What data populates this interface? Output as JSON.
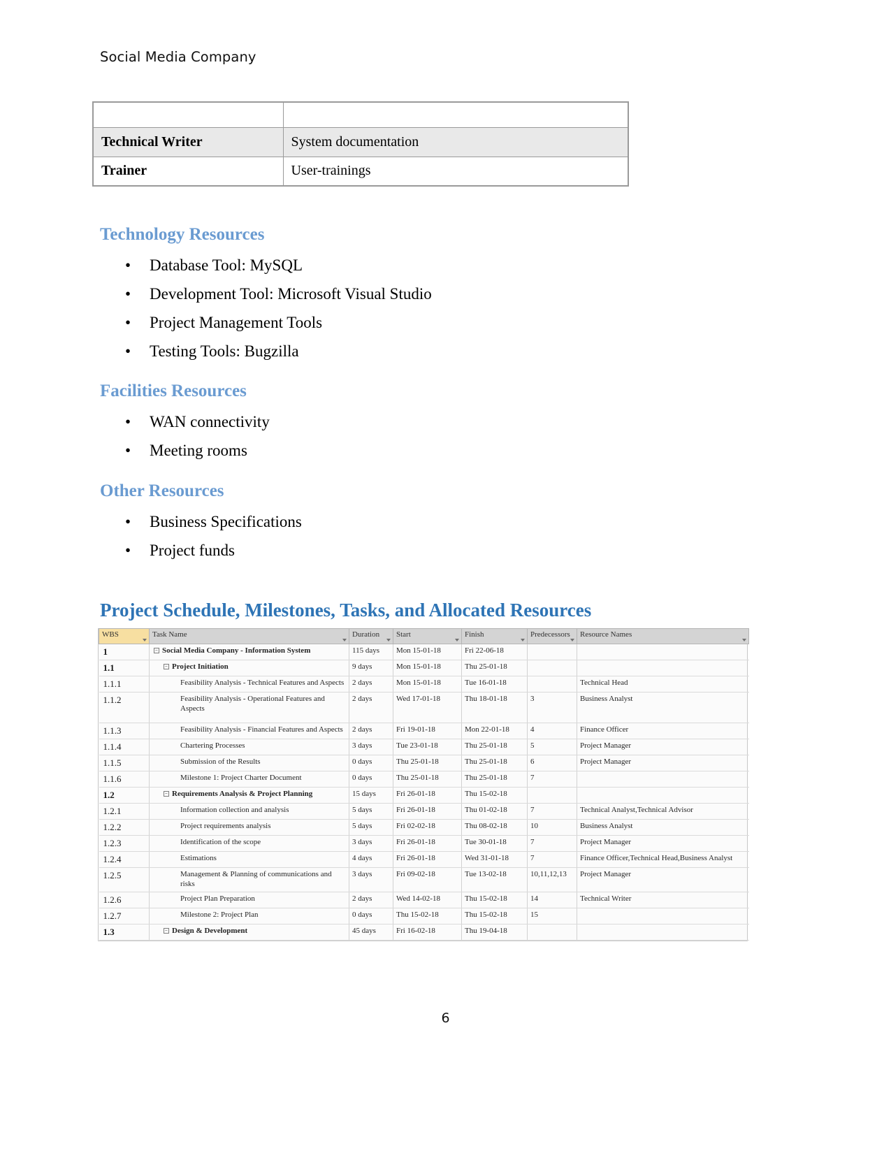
{
  "document": {
    "header_text": "Social Media Company",
    "page_number": "6"
  },
  "roles_table": {
    "rows": [
      {
        "role": "",
        "description": ""
      },
      {
        "role": "Technical Writer",
        "description": "System documentation"
      },
      {
        "role": "Trainer",
        "description": "User-trainings"
      }
    ]
  },
  "sections": [
    {
      "heading": "Technology Resources",
      "items": [
        "Database Tool: MySQL",
        "Development Tool: Microsoft Visual Studio",
        "Project Management Tools",
        "Testing Tools: Bugzilla"
      ]
    },
    {
      "heading": "Facilities Resources",
      "items": [
        "WAN connectivity",
        "Meeting rooms"
      ]
    },
    {
      "heading": "Other Resources",
      "items": [
        "Business Specifications",
        "Project funds"
      ]
    }
  ],
  "schedule": {
    "heading": "Project Schedule, Milestones, Tasks, and Allocated Resources",
    "bullet_glyph": "•",
    "expander_glyph": "−",
    "columns": [
      "WBS",
      "Task Name",
      "Duration",
      "Start",
      "Finish",
      "Predecessors",
      "Resource Names"
    ],
    "rows": [
      {
        "wbs": "1",
        "task": "Social Media Company - Information System",
        "duration": "115 days",
        "start": "Mon 15-01-18",
        "finish": "Fri 22-06-18",
        "predecessors": "",
        "resources": "",
        "level": 0,
        "summary": true
      },
      {
        "wbs": "1.1",
        "task": "Project Initiation",
        "duration": "9 days",
        "start": "Mon 15-01-18",
        "finish": "Thu 25-01-18",
        "predecessors": "",
        "resources": "",
        "level": 1,
        "summary": true
      },
      {
        "wbs": "1.1.1",
        "task": "Feasibility Analysis - Technical Features and Aspects",
        "duration": "2 days",
        "start": "Mon 15-01-18",
        "finish": "Tue 16-01-18",
        "predecessors": "",
        "resources": "Technical Head",
        "level": 2,
        "summary": false
      },
      {
        "wbs": "1.1.2",
        "task": "Feasibility Analysis - Operational Features and Aspects",
        "duration": "2 days",
        "start": "Wed 17-01-18",
        "finish": "Thu 18-01-18",
        "predecessors": "3",
        "resources": "Business Analyst",
        "level": 2,
        "summary": false,
        "tall": true
      },
      {
        "wbs": "1.1.3",
        "task": "Feasibility Analysis - Financial Features and Aspects",
        "duration": "2 days",
        "start": "Fri 19-01-18",
        "finish": "Mon 22-01-18",
        "predecessors": "4",
        "resources": "Finance Officer",
        "level": 2,
        "summary": false
      },
      {
        "wbs": "1.1.4",
        "task": "Chartering Processes",
        "duration": "3 days",
        "start": "Tue 23-01-18",
        "finish": "Thu 25-01-18",
        "predecessors": "5",
        "resources": "Project Manager",
        "level": 2,
        "summary": false
      },
      {
        "wbs": "1.1.5",
        "task": "Submission of the Results",
        "duration": "0 days",
        "start": "Thu 25-01-18",
        "finish": "Thu 25-01-18",
        "predecessors": "6",
        "resources": "Project Manager",
        "level": 2,
        "summary": false
      },
      {
        "wbs": "1.1.6",
        "task": "Milestone 1: Project Charter Document",
        "duration": "0 days",
        "start": "Thu 25-01-18",
        "finish": "Thu 25-01-18",
        "predecessors": "7",
        "resources": "",
        "level": 2,
        "summary": false
      },
      {
        "wbs": "1.2",
        "task": "Requirements Analysis & Project Planning",
        "duration": "15 days",
        "start": "Fri 26-01-18",
        "finish": "Thu 15-02-18",
        "predecessors": "",
        "resources": "",
        "level": 1,
        "summary": true
      },
      {
        "wbs": "1.2.1",
        "task": "Information collection and analysis",
        "duration": "5 days",
        "start": "Fri 26-01-18",
        "finish": "Thu 01-02-18",
        "predecessors": "7",
        "resources": "Technical Analyst,Technical Advisor",
        "level": 2,
        "summary": false
      },
      {
        "wbs": "1.2.2",
        "task": "Project requirements analysis",
        "duration": "5 days",
        "start": "Fri 02-02-18",
        "finish": "Thu 08-02-18",
        "predecessors": "10",
        "resources": "Business Analyst",
        "level": 2,
        "summary": false
      },
      {
        "wbs": "1.2.3",
        "task": "Identification of the scope",
        "duration": "3 days",
        "start": "Fri 26-01-18",
        "finish": "Tue 30-01-18",
        "predecessors": "7",
        "resources": "Project Manager",
        "level": 2,
        "summary": false
      },
      {
        "wbs": "1.2.4",
        "task": "Estimations",
        "duration": "4 days",
        "start": "Fri 26-01-18",
        "finish": "Wed 31-01-18",
        "predecessors": "7",
        "resources": "Finance Officer,Technical Head,Business Analyst",
        "level": 2,
        "summary": false
      },
      {
        "wbs": "1.2.5",
        "task": "Management & Planning of communications and risks",
        "duration": "3 days",
        "start": "Fri 09-02-18",
        "finish": "Tue 13-02-18",
        "predecessors": "10,11,12,13",
        "resources": "Project Manager",
        "level": 2,
        "summary": false
      },
      {
        "wbs": "1.2.6",
        "task": "Project Plan Preparation",
        "duration": "2 days",
        "start": "Wed 14-02-18",
        "finish": "Thu 15-02-18",
        "predecessors": "14",
        "resources": "Technical Writer",
        "level": 2,
        "summary": false
      },
      {
        "wbs": "1.2.7",
        "task": "Milestone 2: Project Plan",
        "duration": "0 days",
        "start": "Thu 15-02-18",
        "finish": "Thu 15-02-18",
        "predecessors": "15",
        "resources": "",
        "level": 2,
        "summary": false
      },
      {
        "wbs": "1.3",
        "task": "Design & Development",
        "duration": "45 days",
        "start": "Fri 16-02-18",
        "finish": "Thu 19-04-18",
        "predecessors": "",
        "resources": "",
        "level": 1,
        "summary": true
      }
    ]
  },
  "colors": {
    "heading_blue": "#6a9bd1",
    "main_heading_blue": "#2e74b5",
    "wbs_header_yellow": "#fbe2a0",
    "table_header_grey": "#d6d6d6",
    "row_shade": "#e9e9e9"
  }
}
